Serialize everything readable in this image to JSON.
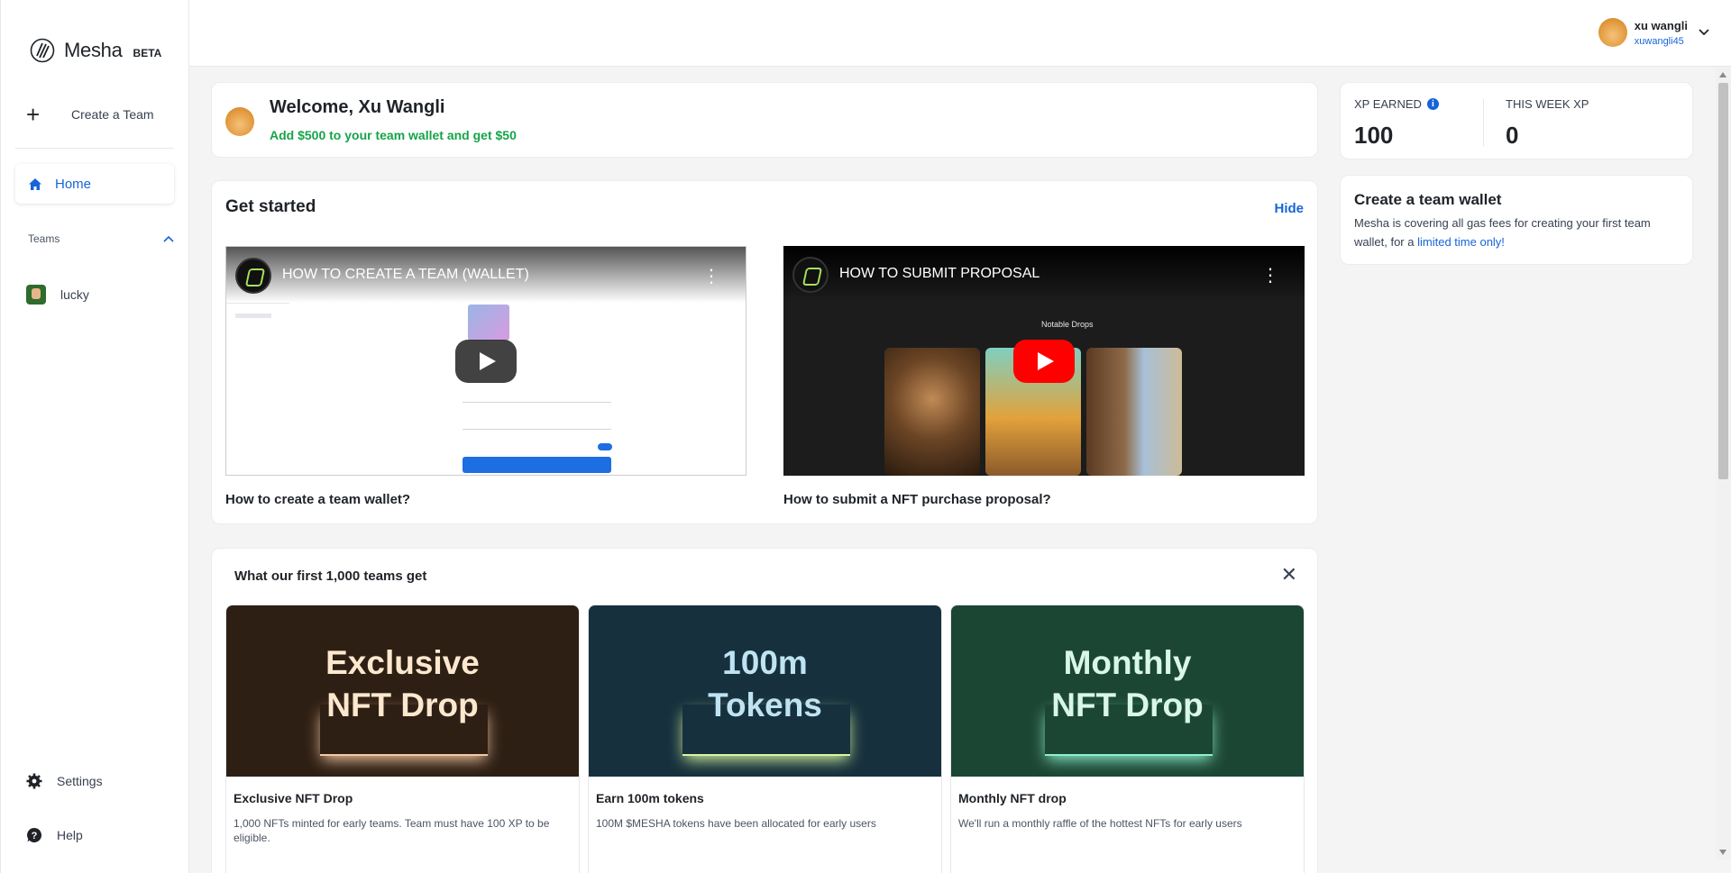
{
  "brand": {
    "name": "Mesha",
    "badge": "BETA"
  },
  "sidebar": {
    "create_team": "Create a Team",
    "home": "Home",
    "teams_label": "Teams",
    "teams": [
      {
        "name": "lucky"
      }
    ],
    "settings": "Settings",
    "help": "Help"
  },
  "user": {
    "name": "xu wangli",
    "handle": "xuwangli45"
  },
  "welcome": {
    "title": "Welcome, Xu Wangli",
    "promo": "Add $500 to your team wallet and get $50"
  },
  "get_started": {
    "title": "Get started",
    "hide": "Hide",
    "videos": [
      {
        "title": "HOW TO CREATE A TEAM (WALLET)",
        "caption": "How to create a team wallet?"
      },
      {
        "title": "HOW TO SUBMIT PROPOSAL",
        "caption": "How to submit a NFT purchase proposal?",
        "overlay_text": "Notable Drops"
      }
    ]
  },
  "first_teams": {
    "title": "What our first 1,000 teams get",
    "perks": [
      {
        "banner_line1": "Exclusive",
        "banner_line2": "NFT Drop",
        "name": "Exclusive NFT Drop",
        "desc": "1,000 NFTs minted for early teams. Team must have 100 XP to be eligible.",
        "bg": "#2e1f14",
        "fg": "#fde8cf",
        "glow": "#f5c9a4"
      },
      {
        "banner_line1": "100m",
        "banner_line2": "Tokens",
        "name": "Earn 100m tokens",
        "desc": "100M $MESHA tokens have been allocated for early users",
        "bg": "#16303d",
        "fg": "#bfe3f3",
        "glow": "#d9f7a0"
      },
      {
        "banner_line1": "Monthly",
        "banner_line2": "NFT Drop",
        "name": "Monthly NFT drop",
        "desc": "We'll run a monthly raffle of the hottest NFTs for early users",
        "bg": "#1c4634",
        "fg": "#d9f7e8",
        "glow": "#8ff0d0"
      }
    ]
  },
  "xp": {
    "earned_label": "XP EARNED",
    "earned_value": "100",
    "week_label": "THIS WEEK XP",
    "week_value": "0"
  },
  "wallet_promo": {
    "title": "Create a team wallet",
    "desc": "Mesha is covering all gas fees for creating your first team wallet, for a",
    "link": "limited time only!"
  },
  "colors": {
    "accent": "#1565d8",
    "promo_green": "#16a34a"
  }
}
